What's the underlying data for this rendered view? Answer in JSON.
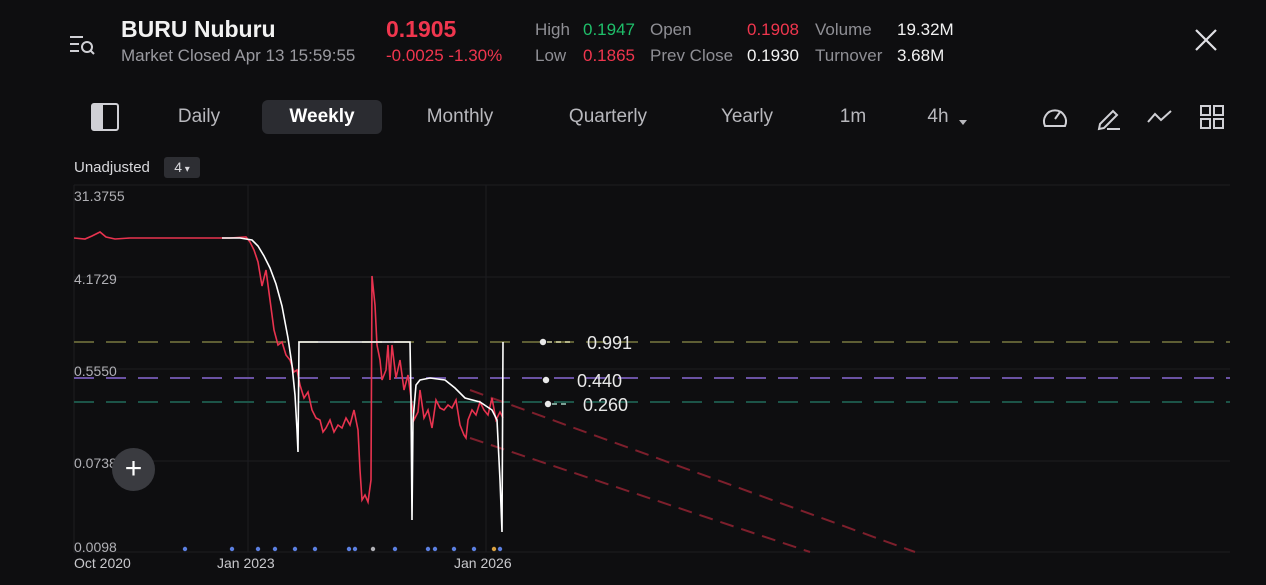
{
  "header": {
    "symbol": "BURU  Nuburu",
    "status": "Market Closed Apr 13 15:59:55",
    "price": "0.1905",
    "change": "-0.0025 -1.30%",
    "stats": {
      "high_label": "High",
      "high": "0.1947",
      "low_label": "Low",
      "low": "0.1865",
      "open_label": "Open",
      "open": "0.1908",
      "prev_close_label": "Prev Close",
      "prev_close": "0.1930",
      "volume_label": "Volume",
      "volume": "19.32M",
      "turnover_label": "Turnover",
      "turnover": "3.68M"
    }
  },
  "tabs": [
    {
      "label": "Daily"
    },
    {
      "label": "Weekly",
      "active": true
    },
    {
      "label": "Monthly"
    },
    {
      "label": "Quarterly"
    },
    {
      "label": "Yearly"
    },
    {
      "label": "1m"
    },
    {
      "label": "4h"
    }
  ],
  "toolbar": {
    "adjust_label": "Unadjusted",
    "indicator_count": "4"
  },
  "chart": {
    "y_ticks": [
      "31.3755",
      "4.1729",
      "0.5550",
      "0.0738",
      "0.0098"
    ],
    "x_ticks": [
      "Oct 2020",
      "Jan 2023",
      "Jan 2026"
    ],
    "levels": [
      "0.991",
      "0.440",
      "0.260"
    ],
    "colors": {
      "price_line": "#e8334f",
      "fit_line": "#ffffff",
      "level_0_991": "#6b6b3a",
      "level_0_440": "#6f56a8",
      "level_0_260": "#1f5a4e",
      "channel": "#8a2230",
      "event_dot": "#5b7fe0",
      "event_dot_alt": "#d8a040"
    }
  }
}
